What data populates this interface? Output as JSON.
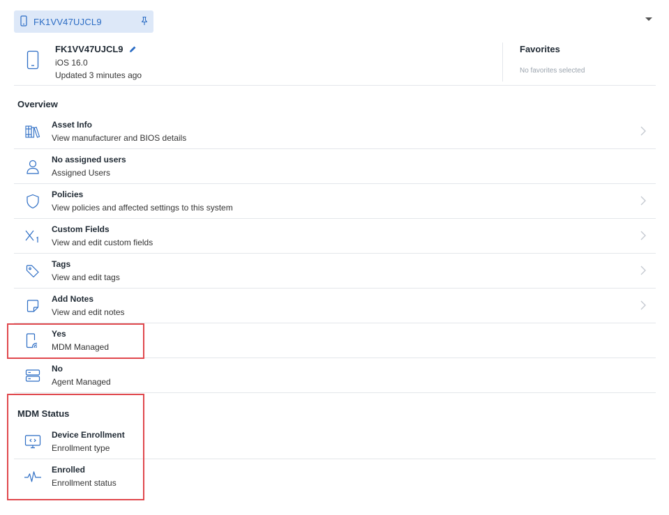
{
  "tab": {
    "label": "FK1VV47UJCL9"
  },
  "device": {
    "name": "FK1VV47UJCL9",
    "os": "iOS 16.0",
    "updated": "Updated 3 minutes ago"
  },
  "favorites": {
    "title": "Favorites",
    "empty_text": "No favorites selected"
  },
  "overview": {
    "title": "Overview",
    "items": [
      {
        "title": "Asset Info",
        "subtitle": "View manufacturer and BIOS details",
        "icon": "books-icon",
        "chevron": true
      },
      {
        "title": "No assigned users",
        "subtitle": "Assigned Users",
        "icon": "user-icon",
        "chevron": false
      },
      {
        "title": "Policies",
        "subtitle": "View policies and affected settings to this system",
        "icon": "shield-icon",
        "chevron": true
      },
      {
        "title": "Custom Fields",
        "subtitle": "View and edit custom fields",
        "icon": "variable-icon",
        "chevron": true
      },
      {
        "title": "Tags",
        "subtitle": "View and edit tags",
        "icon": "tag-icon",
        "chevron": true
      },
      {
        "title": "Add Notes",
        "subtitle": "View and edit notes",
        "icon": "note-icon",
        "chevron": true
      },
      {
        "title": "Yes",
        "subtitle": "MDM Managed",
        "icon": "mdm-device-icon",
        "chevron": false
      },
      {
        "title": "No",
        "subtitle": "Agent Managed",
        "icon": "server-icon",
        "chevron": false
      }
    ]
  },
  "mdm_status": {
    "title": "MDM Status",
    "items": [
      {
        "title": "Device Enrollment",
        "subtitle": "Enrollment type",
        "icon": "monitor-code-icon"
      },
      {
        "title": "Enrolled",
        "subtitle": "Enrollment status",
        "icon": "pulse-icon"
      }
    ]
  },
  "colors": {
    "accent": "#2b6cc4",
    "chip_bg": "#dde8f8",
    "highlight": "#e0474c",
    "divider": "#e3e6ea"
  }
}
